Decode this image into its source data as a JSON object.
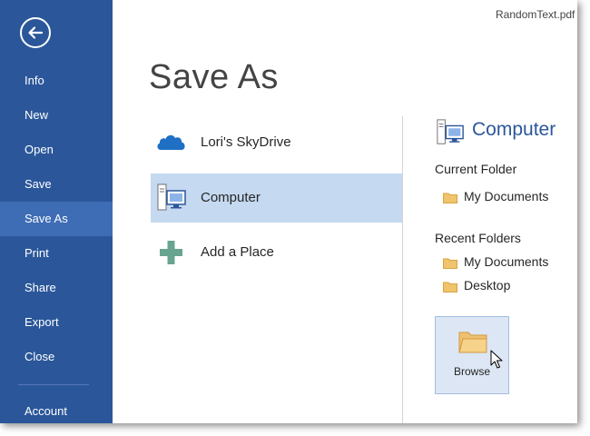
{
  "window": {
    "filename": "RandomText.pdf"
  },
  "sidebar": {
    "back_icon": "arrow-left-icon",
    "items": [
      {
        "label": "Info"
      },
      {
        "label": "New"
      },
      {
        "label": "Open"
      },
      {
        "label": "Save"
      },
      {
        "label": "Save As",
        "active": true
      },
      {
        "label": "Print"
      },
      {
        "label": "Share"
      },
      {
        "label": "Export"
      },
      {
        "label": "Close"
      },
      {
        "label": "Account"
      }
    ]
  },
  "main": {
    "title": "Save As",
    "places": [
      {
        "label": "Lori's SkyDrive",
        "icon": "cloud-icon"
      },
      {
        "label": "Computer",
        "icon": "computer-icon",
        "selected": true
      },
      {
        "label": "Add a Place",
        "icon": "plus-icon"
      }
    ]
  },
  "right_panel": {
    "title": "Computer",
    "current_folder_label": "Current Folder",
    "current_folders": [
      {
        "label": "My Documents"
      }
    ],
    "recent_folders_label": "Recent Folders",
    "recent_folders": [
      {
        "label": "My Documents"
      },
      {
        "label": "Desktop"
      }
    ],
    "browse_label": "Browse"
  },
  "colors": {
    "sidebar": "#2b579a",
    "sidebar_active": "#3e6db5",
    "selected_place": "#c5d9f1",
    "accent": "#2b579a",
    "folder": "#f0c36d"
  }
}
